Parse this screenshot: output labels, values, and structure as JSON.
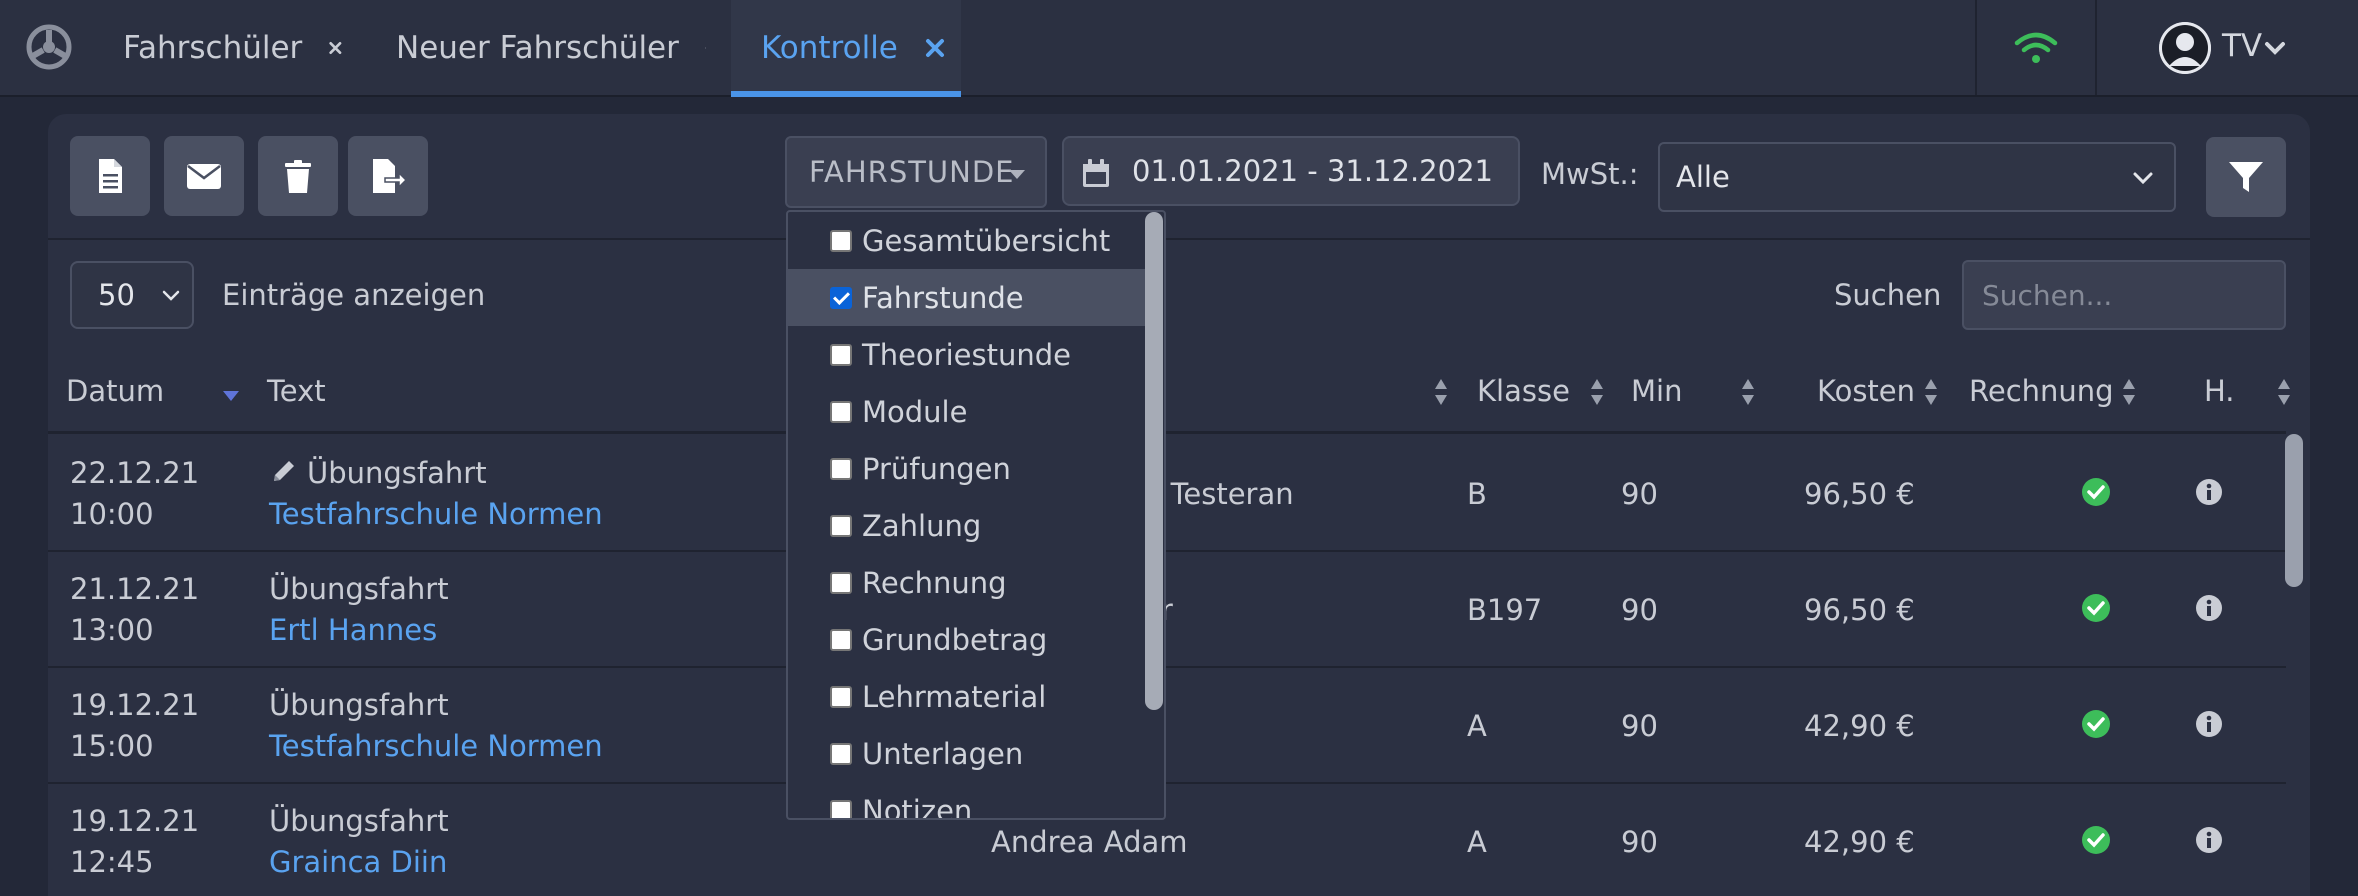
{
  "tabs": [
    {
      "label": "Fahrschüler",
      "active": false
    },
    {
      "label": "Neuer Fahrschüler",
      "active": false
    },
    {
      "label": "Kontrolle",
      "active": true
    }
  ],
  "user": {
    "initials": "TV"
  },
  "toolbar": {
    "type_select": "FAHRSTUNDE",
    "date_range": "01.01.2021 - 31.12.2021",
    "mwst_label": "MwSt.:",
    "mwst_value": "Alle"
  },
  "table_controls": {
    "page_length": "50",
    "page_length_label": "Einträge anzeigen",
    "search_label": "Suchen",
    "search_placeholder": "Suchen..."
  },
  "columns": [
    "Datum",
    "Text",
    "Klasse",
    "Min",
    "Kosten",
    "Rechnung",
    "H."
  ],
  "rows": [
    {
      "date": "22.12.21",
      "time": "10:00",
      "text": "Übungsfahrt",
      "edit_icon": true,
      "school": "Testfahrschule Normen",
      "person": "n Testeran",
      "klasse": "B",
      "min": "90",
      "kosten": "96,50 €"
    },
    {
      "date": "21.12.21",
      "time": "13:00",
      "text": "Übungsfahrt",
      "edit_icon": false,
      "school": "Ertl Hannes",
      "person": "er",
      "klasse": "B197",
      "min": "90",
      "kosten": "96,50 €"
    },
    {
      "date": "19.12.21",
      "time": "15:00",
      "text": "Übungsfahrt",
      "edit_icon": false,
      "school": "Testfahrschule Normen",
      "person": "",
      "klasse": "A",
      "min": "90",
      "kosten": "42,90 €"
    },
    {
      "date": "19.12.21",
      "time": "12:45",
      "text": "Übungsfahrt",
      "edit_icon": false,
      "school": "Grainca Diin",
      "person": "Andrea Adam",
      "klasse": "A",
      "min": "90",
      "kosten": "42,90 €"
    }
  ],
  "dropdown": {
    "items": [
      {
        "label": "Gesamtübersicht",
        "checked": false
      },
      {
        "label": "Fahrstunde",
        "checked": true
      },
      {
        "label": "Theoriestunde",
        "checked": false
      },
      {
        "label": "Module",
        "checked": false
      },
      {
        "label": "Prüfungen",
        "checked": false
      },
      {
        "label": "Zahlung",
        "checked": false
      },
      {
        "label": "Rechnung",
        "checked": false
      },
      {
        "label": "Grundbetrag",
        "checked": false
      },
      {
        "label": "Lehrmaterial",
        "checked": false
      },
      {
        "label": "Unterlagen",
        "checked": false
      },
      {
        "label": "Notizen",
        "checked": false
      }
    ]
  },
  "colors": {
    "accent": "#4a94e8",
    "link": "#5aa3f0",
    "success": "#3dbd5a",
    "background": "#232838",
    "panel": "#2b3042"
  },
  "icons": {
    "logo": "steering-wheel-icon",
    "tab_close": "close-icon",
    "connection": "wifi-icon",
    "user": "user-avatar-icon",
    "toolbar": [
      "document-icon",
      "envelope-icon",
      "trash-icon",
      "export-icon"
    ],
    "filter": "filter-icon",
    "date": "calendar-icon",
    "edit": "pencil-icon",
    "status": "check-circle-icon",
    "detail": "info-circle-icon"
  }
}
